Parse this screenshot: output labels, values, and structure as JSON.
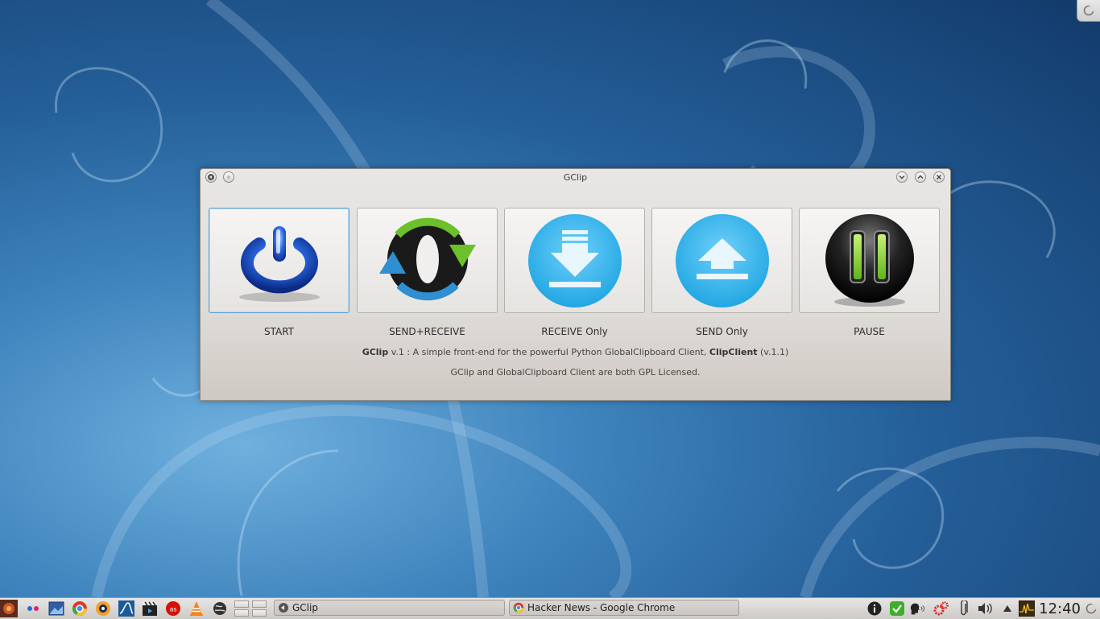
{
  "window": {
    "title": "GClip",
    "buttons": [
      {
        "label": "START",
        "icon": "power-icon"
      },
      {
        "label": "SEND+RECEIVE",
        "icon": "sync-arrows-icon"
      },
      {
        "label": "RECEIVE Only",
        "icon": "download-arrow-icon"
      },
      {
        "label": "SEND Only",
        "icon": "upload-arrow-icon"
      },
      {
        "label": "PAUSE",
        "icon": "pause-icon"
      }
    ],
    "info": {
      "app_name": "GClip",
      "line1_a": " v.1 : A simple front-end for the powerful Python GlobalClipboard Client, ",
      "client_name": "ClipClient",
      "line1_b": " (v.1.1)",
      "line2": "GClip and GlobalClipboard Client are both GPL Licensed."
    }
  },
  "taskbar": {
    "tasks": [
      {
        "label": "GClip",
        "icon": "kde-window-icon"
      },
      {
        "label": "Hacker News - Google Chrome",
        "icon": "chrome-icon"
      }
    ],
    "clock": "12:40"
  },
  "colors": {
    "accent": "#5f9fd3",
    "desktop": "#25609a",
    "download_blue": "#2fb0e6",
    "pause_green": "#7fd12b"
  }
}
